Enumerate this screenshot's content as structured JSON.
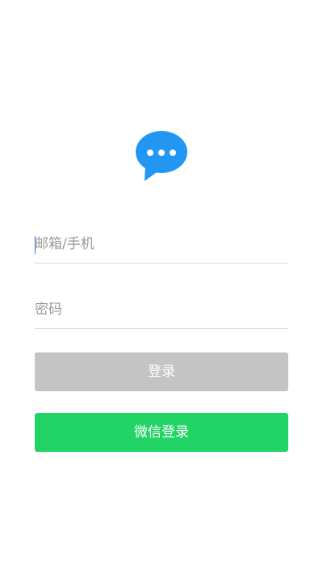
{
  "logo": {
    "icon": "chat-bubble-icon",
    "color": "#2196f3"
  },
  "form": {
    "account_placeholder": "邮箱/手机",
    "account_value": "",
    "password_placeholder": "密码",
    "password_value": ""
  },
  "buttons": {
    "login_label": "登录",
    "wechat_login_label": "微信登录",
    "login_color": "#c4c4c4",
    "wechat_color": "#22d365"
  }
}
